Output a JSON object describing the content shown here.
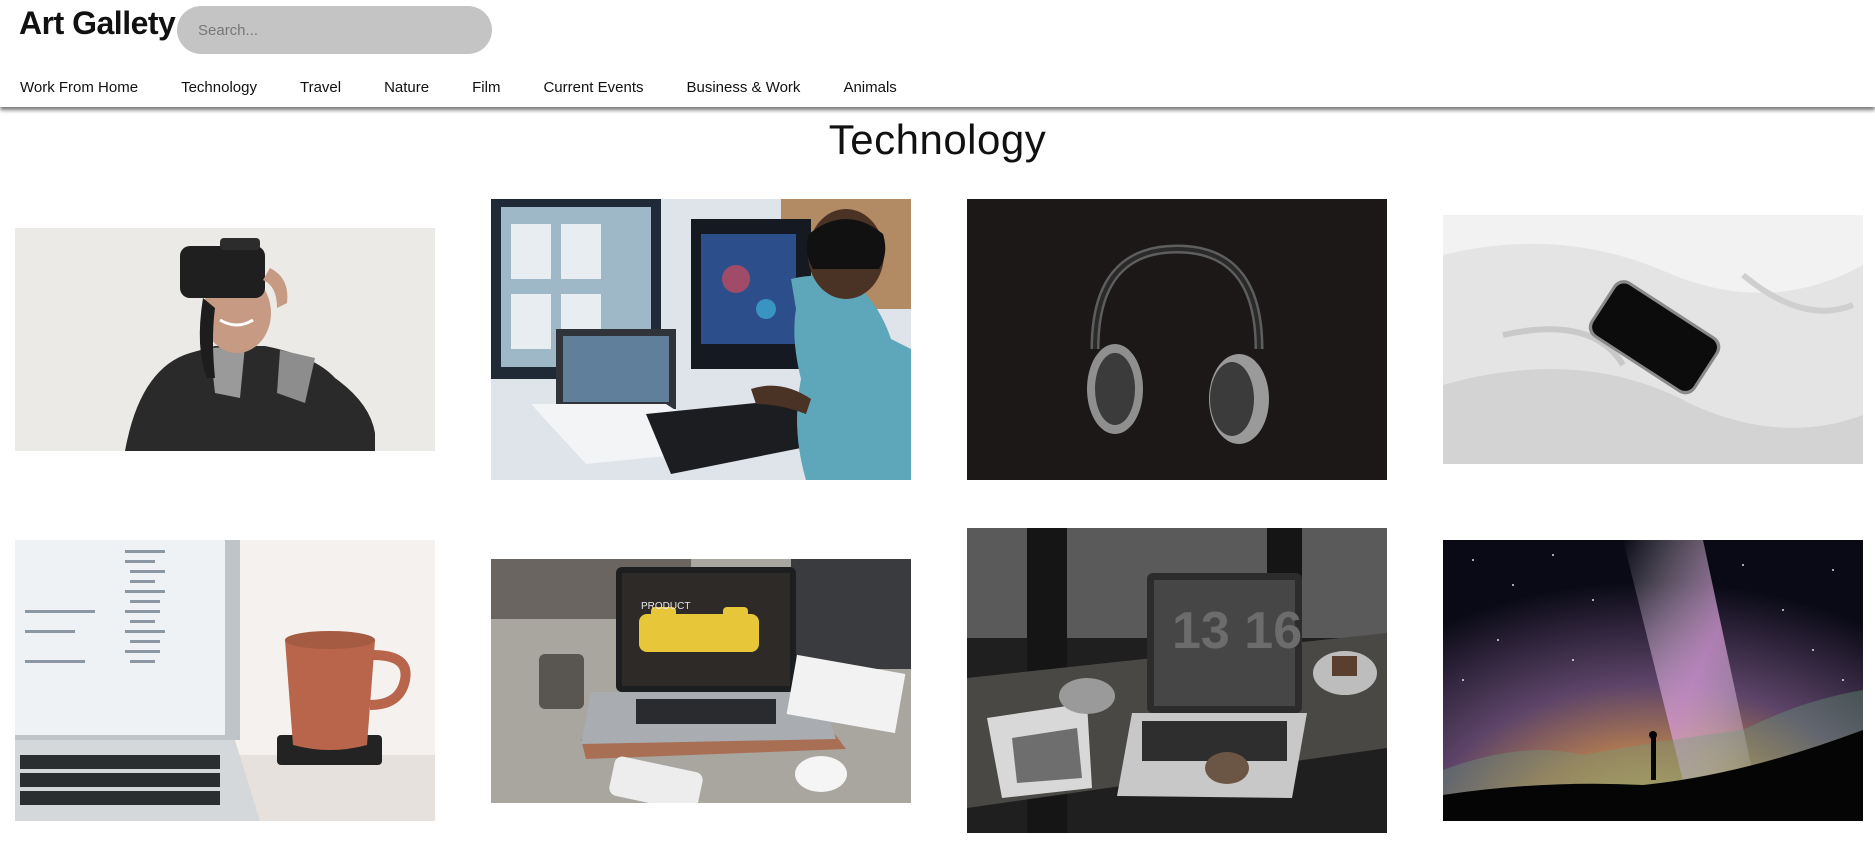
{
  "app": {
    "title": "Art Gallety"
  },
  "search": {
    "placeholder": "Search..."
  },
  "nav": {
    "items": [
      {
        "label": "Work From Home"
      },
      {
        "label": "Technology"
      },
      {
        "label": "Travel"
      },
      {
        "label": "Nature"
      },
      {
        "label": "Film"
      },
      {
        "label": "Current Events"
      },
      {
        "label": "Business & Work"
      },
      {
        "label": "Animals"
      }
    ]
  },
  "main": {
    "title": "Technology"
  },
  "gallery": {
    "images": [
      {
        "subject": "woman-vr-headset"
      },
      {
        "subject": "man-at-computer-desk"
      },
      {
        "subject": "headphones-dark-background"
      },
      {
        "subject": "smartphone-on-bedsheet"
      },
      {
        "subject": "laptop-and-mug"
      },
      {
        "subject": "laptop-on-desk-product"
      },
      {
        "subject": "laptop-coffee-magazine"
      },
      {
        "subject": "night-sky-milky-way"
      }
    ],
    "laptop_screen_text": "PRODUCT",
    "clock_text": "13 16"
  }
}
